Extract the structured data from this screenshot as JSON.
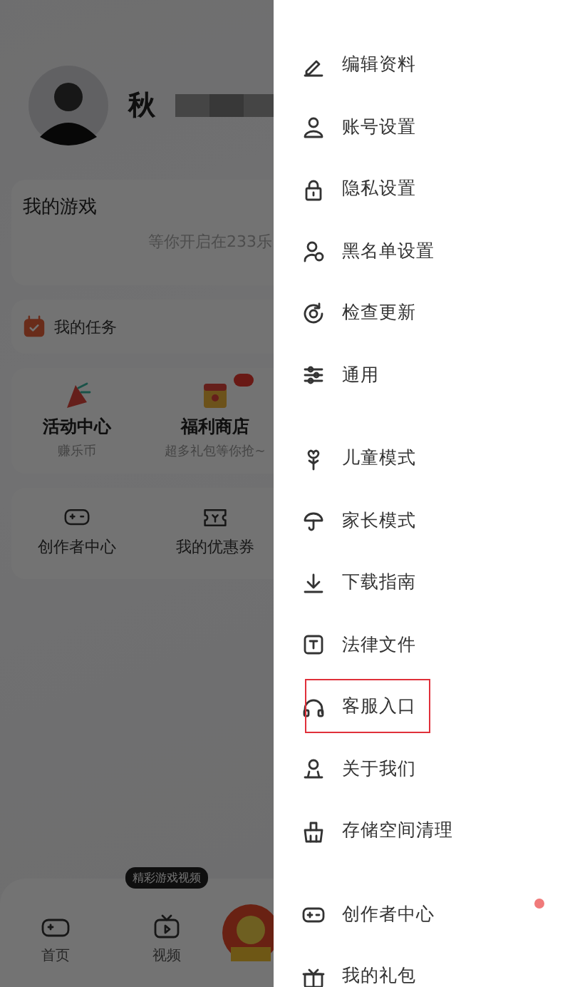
{
  "profile": {
    "name": "秋"
  },
  "my_games": {
    "title": "我的游戏",
    "hint": "等你开启在233乐"
  },
  "tasks": {
    "title": "我的任务"
  },
  "features": [
    {
      "title": "活动中心",
      "subtitle": "赚乐币",
      "badge": false
    },
    {
      "title": "福利商店",
      "subtitle": "超多礼包等你抢~",
      "badge": true
    }
  ],
  "shortcuts": [
    {
      "label": "创作者中心"
    },
    {
      "label": "我的优惠券"
    }
  ],
  "tab_bar": {
    "items": [
      {
        "label": "首页"
      },
      {
        "label": "视频",
        "tooltip": "精彩游戏视频"
      }
    ]
  },
  "drawer": {
    "groups": [
      {
        "items": [
          {
            "label": "编辑资料",
            "highlighted": false,
            "badge_dot": false
          },
          {
            "label": "账号设置",
            "highlighted": false,
            "badge_dot": false
          },
          {
            "label": "隐私设置",
            "highlighted": false,
            "badge_dot": false
          },
          {
            "label": "黑名单设置",
            "highlighted": false,
            "badge_dot": false
          },
          {
            "label": "检查更新",
            "highlighted": false,
            "badge_dot": false
          },
          {
            "label": "通用",
            "highlighted": false,
            "badge_dot": false
          }
        ]
      },
      {
        "items": [
          {
            "label": "儿童模式",
            "highlighted": false,
            "badge_dot": false
          },
          {
            "label": "家长模式",
            "highlighted": false,
            "badge_dot": false
          },
          {
            "label": "下载指南",
            "highlighted": false,
            "badge_dot": false
          },
          {
            "label": "法律文件",
            "highlighted": false,
            "badge_dot": false
          },
          {
            "label": "客服入口",
            "highlighted": true,
            "badge_dot": false
          },
          {
            "label": "关于我们",
            "highlighted": false,
            "badge_dot": false
          },
          {
            "label": "存储空间清理",
            "highlighted": false,
            "badge_dot": false
          }
        ]
      },
      {
        "items": [
          {
            "label": "创作者中心",
            "highlighted": false,
            "badge_dot": true
          },
          {
            "label": "我的礼包",
            "highlighted": false,
            "badge_dot": false
          }
        ]
      }
    ]
  }
}
